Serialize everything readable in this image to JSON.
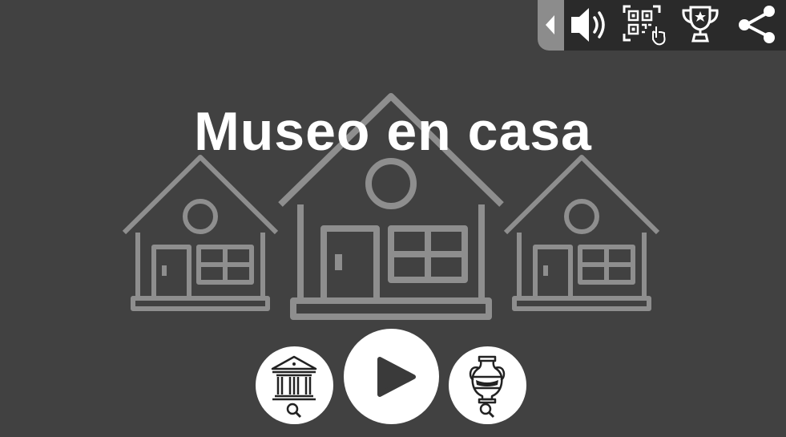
{
  "game": {
    "title": "Museo en casa"
  },
  "toolbar": {
    "collapse_icon": "chevron-left-icon",
    "buttons": [
      {
        "name": "sound",
        "icon": "speaker-icon"
      },
      {
        "name": "qr-download",
        "icon": "qr-code-download-icon"
      },
      {
        "name": "trophy",
        "icon": "trophy-icon"
      },
      {
        "name": "share",
        "icon": "share-icon"
      }
    ]
  },
  "menu": {
    "left_button_icon": "museum-search-icon",
    "center_button_icon": "play-icon",
    "right_button_icon": "vase-search-icon"
  },
  "colors": {
    "background": "#414141",
    "toolbar_bg": "#2a2a2a",
    "tab_bg": "#8c8c8c",
    "house_stroke": "#8e8e8e",
    "title": "#ffffff",
    "button_bg": "#ffffff"
  }
}
